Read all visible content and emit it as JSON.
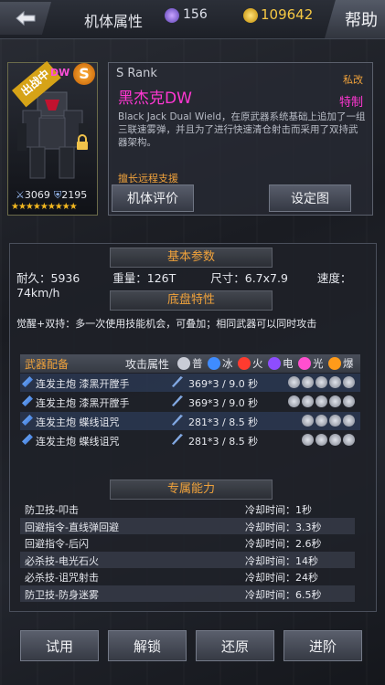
{
  "header": {
    "title": "机体属性",
    "gems": "156",
    "coins": "109642",
    "help_label": "帮助"
  },
  "mech": {
    "badge": "出战中",
    "short_name": "DW",
    "rank_letter": "S",
    "power": "3069",
    "defense": "2195",
    "stars": "★★★★★★★★★"
  },
  "info": {
    "rank": "S  Rank",
    "tag1": "私改",
    "name": "黑杰克DW",
    "tag2": "特制",
    "description": "Black Jack Dual Wield，在原武器系统基础上追加了一组三联速雾弹，并且为了进行快速清仓射击而采用了双持武器架构。",
    "specialty": "擅长远程支援",
    "eval_button": "机体评价",
    "setup_button": "设定图"
  },
  "basic": {
    "title": "基本参数",
    "durability": "耐久：5936",
    "weight": "重量：126T",
    "size": "尺寸：6.7x7.9",
    "speed": "速度：74km/h"
  },
  "chassis": {
    "title": "底盘特性",
    "text": "觉醒+双持：多一次使用技能机会，可叠加；相同武器可以同时攻击"
  },
  "weapons": {
    "header": "武器配备",
    "attack_attr": "攻击属性",
    "elements": [
      {
        "label": "普",
        "color": "#c9ccd6"
      },
      {
        "label": "冰",
        "color": "#3f8cff"
      },
      {
        "label": "火",
        "color": "#ff3b2f"
      },
      {
        "label": "电",
        "color": "#8e4dff"
      },
      {
        "label": "光",
        "color": "#ff4fcf"
      },
      {
        "label": "爆",
        "color": "#ff9b1a"
      }
    ],
    "rows": [
      {
        "name": "连发主炮  漆黑开膛手",
        "damage": "369*3  / 9.0 秒"
      },
      {
        "name": "连发主炮  漆黑开膛手",
        "damage": "369*3  / 9.0 秒"
      },
      {
        "name": "连发主炮  蝶线诅咒",
        "damage": "281*3  / 8.5 秒"
      },
      {
        "name": "连发主炮  蝶线诅咒",
        "damage": "281*3  / 8.5 秒"
      }
    ]
  },
  "exclusive": {
    "title": "专属能力",
    "rows": [
      {
        "name": "防卫技-叩击",
        "cd": "冷却时间：1秒"
      },
      {
        "name": "回避指令-直线弹回避",
        "cd": "冷却时间：3.3秒"
      },
      {
        "name": "回避指令-后闪",
        "cd": "冷却时间：2.6秒"
      },
      {
        "name": "必杀技-电光石火",
        "cd": "冷却时间：14秒"
      },
      {
        "name": "必杀技-诅咒射击",
        "cd": "冷却时间：24秒"
      },
      {
        "name": "防卫技-防身迷雾",
        "cd": "冷却时间：6.5秒"
      }
    ]
  },
  "footer": {
    "trial": "试用",
    "unlock": "解锁",
    "restore": "还原",
    "advance": "进阶"
  }
}
